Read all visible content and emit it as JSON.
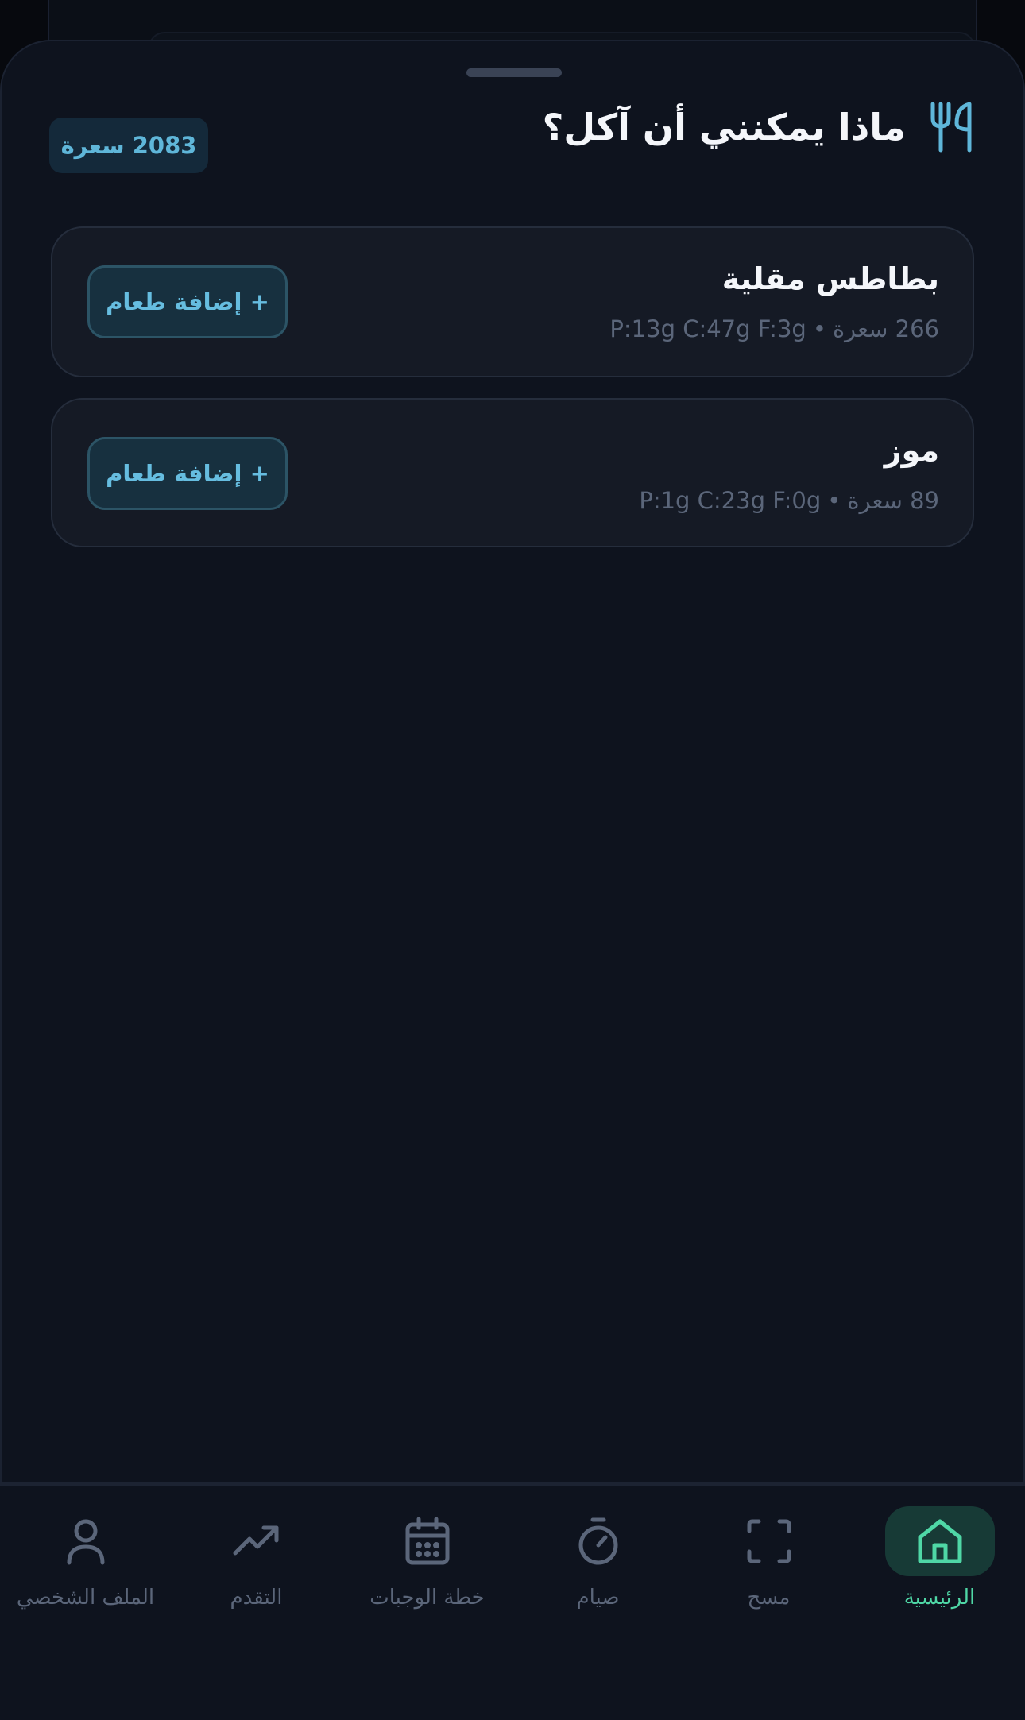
{
  "header": {
    "title": "ماذا يمكنني أن آكل؟",
    "title_icon": "utensils-icon",
    "calorie_badge": "2083 سعرة"
  },
  "foods": [
    {
      "name": "بطاطس مقلية",
      "calories": "266 سعرة",
      "separator": "•",
      "macros": "P:13g C:47g F:3g",
      "add_label": "+ إضافة طعام"
    },
    {
      "name": "موز",
      "calories": "89 سعرة",
      "separator": "•",
      "macros": "P:1g C:23g F:0g",
      "add_label": "+ إضافة طعام"
    }
  ],
  "nav": {
    "items": [
      {
        "label": "الرئيسية",
        "icon": "home-icon",
        "active": true
      },
      {
        "label": "مسح",
        "icon": "scan-icon",
        "active": false
      },
      {
        "label": "صيام",
        "icon": "timer-icon",
        "active": false
      },
      {
        "label": "خطة الوجبات",
        "icon": "calendar-icon",
        "active": false
      },
      {
        "label": "التقدم",
        "icon": "trending-up-icon",
        "active": false
      },
      {
        "label": "الملف الشخصي",
        "icon": "user-icon",
        "active": false
      }
    ]
  },
  "colors": {
    "background": "#0e131e",
    "card": "#151a25",
    "accent_blue": "#5fb6d9",
    "accent_green": "#4fd7a6",
    "muted_text": "#5b667a"
  }
}
